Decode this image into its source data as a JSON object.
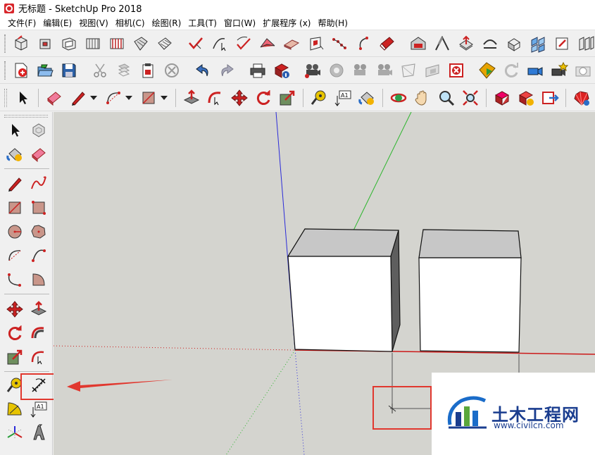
{
  "window": {
    "title": "无标题 - SketchUp Pro 2018"
  },
  "menu": [
    {
      "label": "文件(F)"
    },
    {
      "label": "编辑(E)"
    },
    {
      "label": "视图(V)"
    },
    {
      "label": "相机(C)"
    },
    {
      "label": "绘图(R)"
    },
    {
      "label": "工具(T)"
    },
    {
      "label": "窗口(W)"
    },
    {
      "label": "扩展程序 (x)"
    },
    {
      "label": "帮助(H)"
    }
  ],
  "tool_icons": {
    "text_tool": "A1"
  },
  "watermark": {
    "title": "土木工程网",
    "url": "www.civilcn.com"
  },
  "colors": {
    "highlight": "#e1382f",
    "viewport_bg": "#d4d4cf",
    "blue_axis": "#2b2bd9",
    "green_axis": "#2db52d",
    "red_axis": "#cc1a1a",
    "watermark_text": "#1a3d8f"
  }
}
